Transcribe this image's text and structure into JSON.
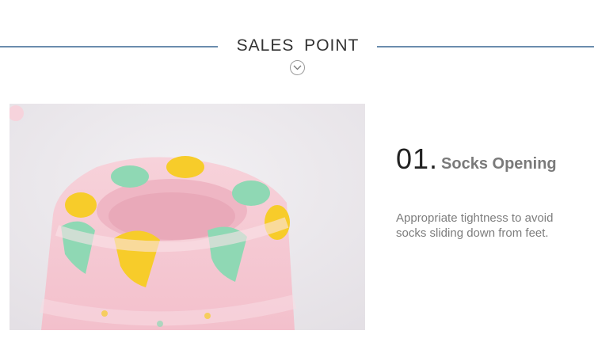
{
  "section": {
    "title": "SALES  POINT",
    "icon": "chevron-down-icon"
  },
  "product_image": {
    "alt": "",
    "colors": {
      "background": "#e9e6ea",
      "sock": "#f6c9d3",
      "yellow": "#f7cc2a",
      "mint": "#8fd8b4"
    }
  },
  "feature": {
    "number": "01.",
    "name": "Socks Opening",
    "description": "Appropriate tightness to avoid socks sliding down from feet."
  },
  "colors": {
    "rule": "#6a8cad",
    "title": "#333333",
    "feature_name": "#7a7a7a"
  }
}
